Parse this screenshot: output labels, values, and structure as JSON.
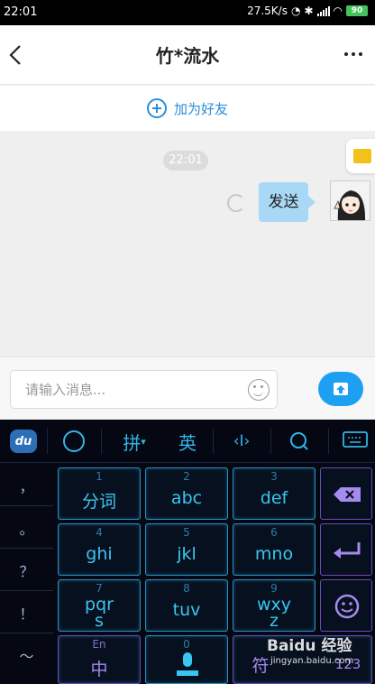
{
  "status_bar": {
    "time": "22:01",
    "network_speed": "27.5K/s",
    "battery": "90"
  },
  "header": {
    "title": "竹*流水"
  },
  "add_friend": {
    "label": "加为好友"
  },
  "chat": {
    "timestamp": "22:01",
    "messages": [
      {
        "text": "发送",
        "from": "me",
        "status": "sending"
      }
    ]
  },
  "input_bar": {
    "placeholder": "请输入消息...",
    "value": ""
  },
  "keyboard": {
    "toolbar": {
      "logo": "du",
      "pinyin": "拼",
      "english": "英"
    },
    "left_column": [
      "，",
      "。",
      "？",
      "！",
      "～"
    ],
    "keys": [
      {
        "num": "1",
        "label": "分词"
      },
      {
        "num": "2",
        "label": "abc"
      },
      {
        "num": "3",
        "label": "def"
      },
      {
        "num": "4",
        "label": "ghi"
      },
      {
        "num": "5",
        "label": "jkl"
      },
      {
        "num": "6",
        "label": "mno"
      },
      {
        "num": "7",
        "label_top": "pqr",
        "label_bottom": "s"
      },
      {
        "num": "8",
        "label": "tuv"
      },
      {
        "num": "9",
        "label_top": "wxy",
        "label_bottom": "z"
      }
    ],
    "bottom_row": {
      "cn_en_small": "En",
      "cn_label": "中",
      "space_num": "0",
      "symbol_label": "符",
      "symbol_num": "123"
    }
  },
  "watermark": {
    "brand": "Baidu 经验",
    "url": "jingyan.baidu.com"
  },
  "colors": {
    "accent_blue": "#1ea0f2",
    "keyboard_cyan": "#39c6f2",
    "keyboard_purple": "#a58af0",
    "bubble": "#a9d8f7"
  }
}
